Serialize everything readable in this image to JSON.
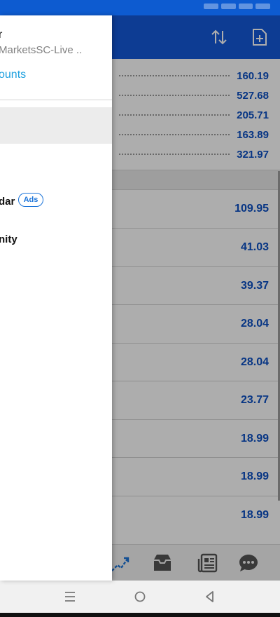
{
  "drawer": {
    "account_name": "r",
    "account_server": "MarketsSC-Live ..",
    "manage_accounts_label": "ounts",
    "menu": [
      {
        "label": "dar",
        "badge": "Ads"
      },
      {
        "label": "nity"
      }
    ]
  },
  "summary": {
    "values": [
      "160.19",
      "527.68",
      "205.71",
      "163.89",
      "321.97"
    ]
  },
  "positions": {
    "values": [
      "109.95",
      "41.03",
      "39.37",
      "28.04",
      "28.04",
      "23.77",
      "18.99",
      "18.99",
      "18.99"
    ]
  },
  "colors": {
    "header_blue": "#1459d9",
    "value_blue": "#0b4fc3",
    "link_blue": "#1ea0df"
  },
  "icons": {
    "header": [
      "sort-arrows-icon",
      "new-document-icon"
    ],
    "bottom_nav": [
      "chart-icon",
      "inbox-icon",
      "news-icon",
      "chat-icon"
    ],
    "system_nav": [
      "menu-icon",
      "home-icon",
      "back-icon"
    ]
  }
}
